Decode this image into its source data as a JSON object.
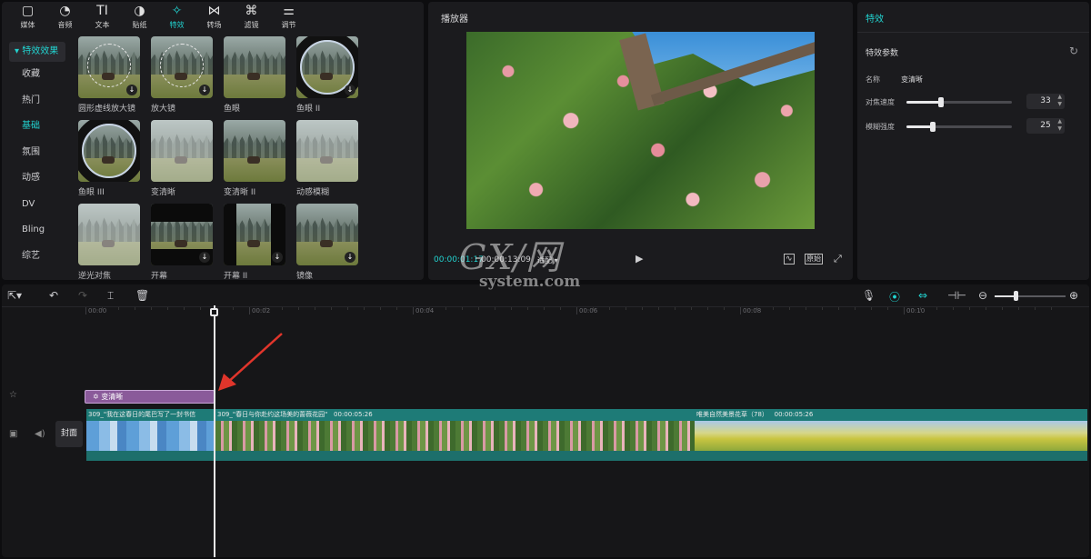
{
  "toolbar": {
    "items": [
      {
        "label": "媒体",
        "icon": "▢"
      },
      {
        "label": "音频",
        "icon": "◔"
      },
      {
        "label": "文本",
        "icon": "TI"
      },
      {
        "label": "贴纸",
        "icon": "◑"
      },
      {
        "label": "特效",
        "icon": "✧"
      },
      {
        "label": "转场",
        "icon": "⋈"
      },
      {
        "label": "滤镜",
        "icon": "⌘"
      },
      {
        "label": "调节",
        "icon": "⚌"
      }
    ],
    "active_index": 4
  },
  "categories": {
    "header": "▾ 特效效果",
    "items": [
      "收藏",
      "热门",
      "基础",
      "氛围",
      "动感",
      "DV",
      "Bling",
      "综艺"
    ],
    "selected_index": 2
  },
  "effects": [
    {
      "name": "圆形虚线放大镜",
      "style": "circle"
    },
    {
      "name": "放大镜",
      "style": "circle"
    },
    {
      "name": "鱼眼",
      "style": "plain"
    },
    {
      "name": "鱼眼 II",
      "style": "globe"
    },
    {
      "name": "鱼眼 III",
      "style": "globe"
    },
    {
      "name": "变清晰",
      "style": "fog"
    },
    {
      "name": "变清晰 II",
      "style": "plain"
    },
    {
      "name": "动感模糊",
      "style": "fog"
    },
    {
      "name": "逆光对焦",
      "style": "fog"
    },
    {
      "name": "开幕",
      "style": "open"
    },
    {
      "name": "开幕 II",
      "style": "open2"
    },
    {
      "name": "镜像",
      "style": "plain"
    }
  ],
  "player": {
    "title": "播放器",
    "current_time": "00:00:01:17",
    "total_time": "00:00:13:09",
    "ratio_label": "适配",
    "original_label": "原始",
    "accent": "#22d3d0"
  },
  "effect_panel": {
    "title": "特效",
    "section": "特效参数",
    "name_label": "名称",
    "name_value": "变清晰",
    "params": [
      {
        "label": "对焦速度",
        "value": 33
      },
      {
        "label": "模糊强度",
        "value": 25
      }
    ]
  },
  "timeline": {
    "ruler": [
      "00:00",
      "00:02",
      "00:04",
      "00:06",
      "00:08",
      "00:10"
    ],
    "effect_clip": "变清晰",
    "cover_label": "封面",
    "clips": [
      {
        "title": "309_\"我在这春日的尾巴写了一封书信",
        "duration": "",
        "color": "#5a8fc8"
      },
      {
        "title": "309_\"春日与你赴约这场美的蔷薇花园\"",
        "duration": "00:00:05:26",
        "color": "#6a8a4a"
      },
      {
        "title": "唯美自然美景花草（78）",
        "duration": "00:00:05:26",
        "color": "#c9c94a"
      }
    ]
  },
  "watermark": {
    "line1": "GX/网",
    "line2": "system.com"
  }
}
